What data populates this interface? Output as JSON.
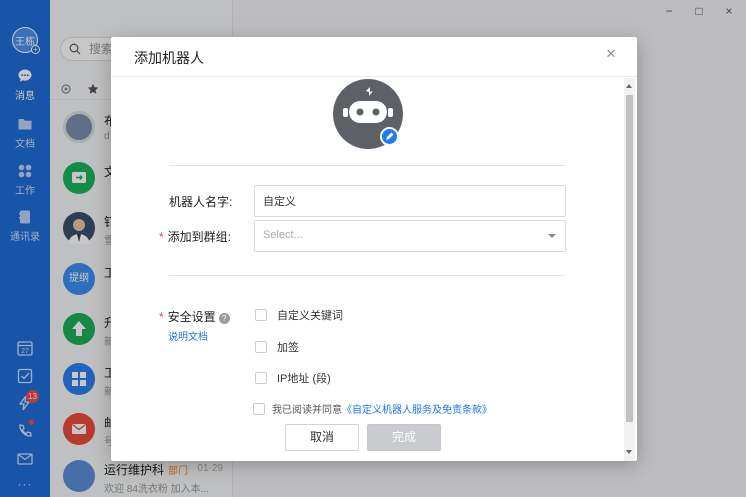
{
  "nav": {
    "user_avatar_text": "王栋",
    "items": [
      {
        "label": "消息"
      },
      {
        "label": "文档"
      },
      {
        "label": "工作"
      },
      {
        "label": "通讯录"
      }
    ],
    "calendar_day": "27",
    "badge_count": "13",
    "more": "···"
  },
  "list": {
    "search_placeholder": "搜索",
    "items": [
      {
        "title": "布",
        "sub": "d"
      },
      {
        "title": "文",
        "sub": ""
      },
      {
        "title": "钉",
        "sub": "雪"
      },
      {
        "title": "工",
        "sub": "",
        "avatar_text": "提纲"
      },
      {
        "title": "升",
        "sub": "新"
      },
      {
        "title": "工",
        "sub": "新"
      },
      {
        "title": "邮",
        "sub": "号"
      },
      {
        "title": "运行维护科",
        "tag": "部门",
        "time": "01-29",
        "sub": "欢迎 84洗衣粉 加入本..."
      }
    ]
  },
  "dialog": {
    "title": "添加机器人",
    "close": "×",
    "name_label": "机器人名字:",
    "name_value": "自定义",
    "group_label": "添加到群组:",
    "group_placeholder": "Select...",
    "security_label": "安全设置",
    "help_mark": "?",
    "doc_link": "说明文档",
    "options": [
      "自定义关键词",
      "加签",
      "IP地址 (段)"
    ],
    "agree_prefix": "我已阅读并同意",
    "agree_link": "《自定义机器人服务及免责条款》",
    "cancel_button": "取消",
    "done_button": "完成",
    "required_mark": "*"
  },
  "window": {
    "minimize": "−",
    "maximize": "□",
    "close": "×"
  },
  "colors": {
    "brand": "#1f6ed8",
    "link": "#1f74e8",
    "required": "#f04848",
    "disabled_button": "#c9cbcf"
  }
}
